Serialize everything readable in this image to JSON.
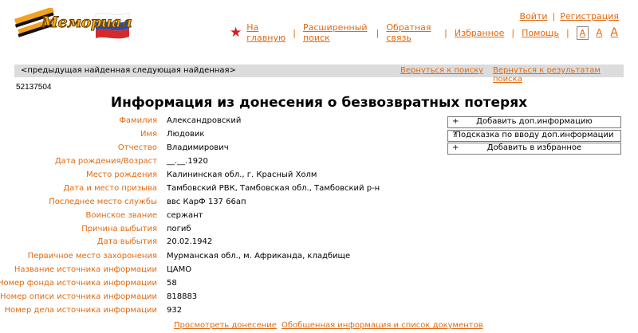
{
  "header": {
    "logo_text": "Мемориал",
    "auth": {
      "login": "Войти",
      "register": "Регистрация"
    },
    "nav": [
      "На главную",
      "Расширенный поиск",
      "Обратная связь",
      "Избранное",
      "Помощь"
    ],
    "font_sizes": [
      "A",
      "A",
      "A"
    ]
  },
  "record_nav": {
    "prev": "<предыдущая найденная",
    "next": "следующая найденная>",
    "back_search": "Вернуться к поиску",
    "back_results": "Вернуться к результатам поиска"
  },
  "record_id": "52137504",
  "title": "Информация из донесения о безвозвратных потерях",
  "fields": [
    {
      "label": "Фамилия",
      "value": "Александровский"
    },
    {
      "label": "Имя",
      "value": "Людовик"
    },
    {
      "label": "Отчество",
      "value": "Владимирович"
    },
    {
      "label": "Дата рождения/Возраст",
      "value": "__.__.1920"
    },
    {
      "label": "Место рождения",
      "value": "Калининская обл., г. Красный Холм"
    },
    {
      "label": "Дата и место призыва",
      "value": "Тамбовский РВК, Тамбовская обл., Тамбовский р-н"
    },
    {
      "label": "Последнее место службы",
      "value": "ввс КарФ 137 66ап"
    },
    {
      "label": "Воинское звание",
      "value": "сержант"
    },
    {
      "label": "Причина выбытия",
      "value": "погиб"
    },
    {
      "label": "Дата выбытия",
      "value": "20.02.1942"
    },
    {
      "label": "Первичное место захоронения",
      "value": "Мурманская обл., м. Африканда, кладбище"
    },
    {
      "label": "Название источника информации",
      "value": "ЦАМО"
    },
    {
      "label": "Номер фонда источника информации",
      "value": "58"
    },
    {
      "label": "Номер описи источника информации",
      "value": "818883"
    },
    {
      "label": "Номер дела источника информации",
      "value": "932"
    }
  ],
  "side_buttons": [
    {
      "icon": "+",
      "label": "Добавить доп.информацию"
    },
    {
      "icon": "?",
      "label": "Подсказка по вводу доп.информации"
    },
    {
      "icon": "+",
      "label": "Добавить в избранное"
    }
  ],
  "bottom_links": {
    "view": "Просмотреть донесение",
    "summary": "Обобщенная информация и список документов"
  },
  "colors": {
    "accent": "#e06a10",
    "star": "#d02020",
    "bar": "#dcdcdc"
  }
}
